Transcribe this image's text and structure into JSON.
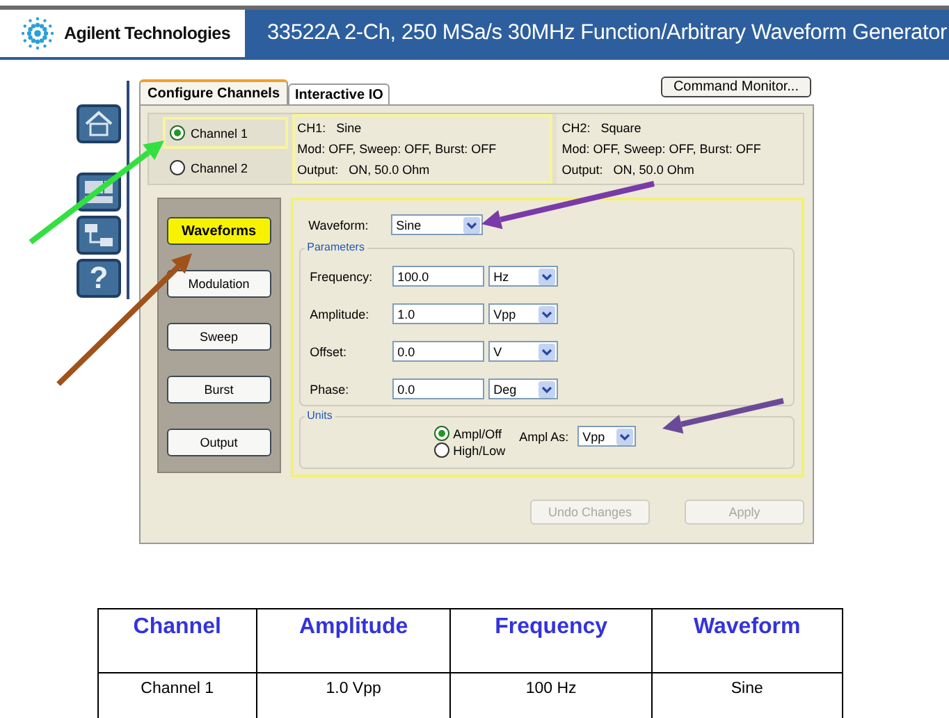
{
  "header": {
    "brand": "Agilent Technologies",
    "title": "33522A 2-Ch, 250 MSa/s 30MHz Function/Arbitrary Waveform Generator"
  },
  "side_icons": [
    {
      "kind": "home"
    },
    {
      "kind": "computer"
    },
    {
      "kind": "network"
    },
    {
      "kind": "help",
      "glyph": "?"
    }
  ],
  "window": {
    "tabs": [
      {
        "label": "Configure Channels",
        "selected": true
      },
      {
        "label": "Interactive IO",
        "selected": false
      }
    ],
    "command_button": "Command Monitor...",
    "channels": [
      {
        "label": "Channel 1",
        "selected": true
      },
      {
        "label": "Channel 2",
        "selected": false
      }
    ],
    "channel_info": [
      {
        "selected": true,
        "lines": [
          "CH1:   Sine",
          "Mod: OFF, Sweep: OFF, Burst: OFF",
          "Output:   ON, 50.0 Ohm"
        ]
      },
      {
        "selected": false,
        "lines": [
          "CH2:   Square",
          "Mod: OFF, Sweep: OFF, Burst: OFF",
          "Output:   ON, 50.0 Ohm"
        ]
      }
    ],
    "nav_buttons": [
      {
        "label": "Waveforms",
        "selected": true
      },
      {
        "label": "Modulation",
        "selected": false
      },
      {
        "label": "Sweep",
        "selected": false
      },
      {
        "label": "Burst",
        "selected": false
      },
      {
        "label": "Output",
        "selected": false
      }
    ],
    "waveform": {
      "label": "Waveform:",
      "value": "Sine"
    },
    "parameters": {
      "title": "Parameters",
      "rows": [
        {
          "label": "Frequency:",
          "value": "100.0",
          "unit": "Hz"
        },
        {
          "label": "Amplitude:",
          "value": "1.0",
          "unit": "Vpp"
        },
        {
          "label": "Offset:",
          "value": "0.0",
          "unit": "V"
        },
        {
          "label": "Phase:",
          "value": "0.0",
          "unit": "Deg"
        }
      ]
    },
    "units": {
      "title": "Units",
      "options": [
        {
          "label": "Ampl/Off",
          "selected": true
        },
        {
          "label": "High/Low",
          "selected": false
        }
      ],
      "ampl_as": {
        "label": "Ampl As:",
        "value": "Vpp"
      }
    },
    "actions": [
      {
        "label": "Undo Changes",
        "disabled": true
      },
      {
        "label": "Apply",
        "disabled": true
      }
    ]
  },
  "table": {
    "columns": [
      "Channel",
      "Amplitude",
      "Frequency",
      "Waveform"
    ],
    "rows": [
      [
        "Channel 1",
        "1.0 Vpp",
        "100 Hz",
        "Sine"
      ]
    ]
  }
}
